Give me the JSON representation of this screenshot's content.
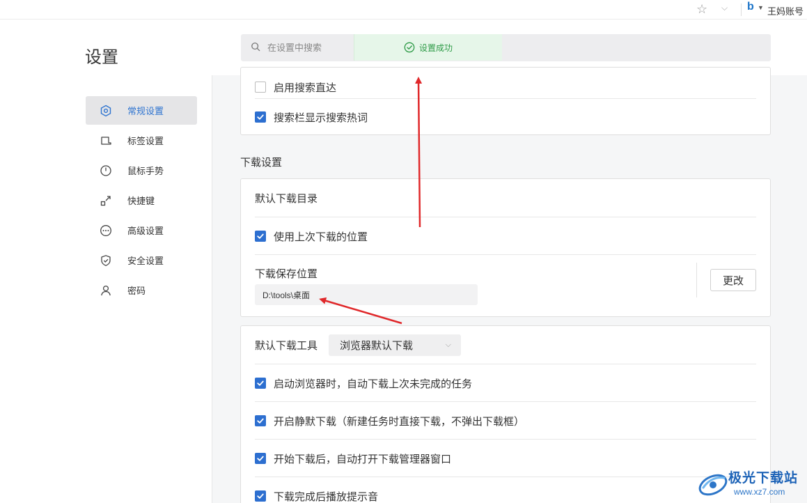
{
  "browser": {
    "account_label": "王妈账号"
  },
  "header": {
    "title": "设置",
    "search_placeholder": "在设置中搜索",
    "toast": "设置成功"
  },
  "sidebar": {
    "items": [
      {
        "label": "常规设置",
        "icon": "hexagon-settings-icon",
        "active": true
      },
      {
        "label": "标签设置",
        "icon": "tab-icon",
        "active": false
      },
      {
        "label": "鼠标手势",
        "icon": "mouse-icon",
        "active": false
      },
      {
        "label": "快捷键",
        "icon": "shortcut-arrow-icon",
        "active": false
      },
      {
        "label": "高级设置",
        "icon": "more-dots-icon",
        "active": false
      },
      {
        "label": "安全设置",
        "icon": "shield-icon",
        "active": false
      },
      {
        "label": "密码",
        "icon": "user-icon",
        "active": false
      }
    ]
  },
  "search_card": {
    "items": [
      {
        "label": "启用搜索直达",
        "checked": false
      },
      {
        "label": "搜索栏显示搜索热词",
        "checked": true
      }
    ]
  },
  "download": {
    "section_title": "下载设置",
    "default_dir_label": "默认下载目录",
    "use_last_location": {
      "label": "使用上次下载的位置",
      "checked": true
    },
    "save_location_label": "下载保存位置",
    "save_path": "D:\\tools\\桌面",
    "change_button": "更改",
    "default_tool_label": "默认下载工具",
    "default_tool_value": "浏览器默认下载",
    "options": [
      {
        "label": "启动浏览器时，自动下载上次未完成的任务",
        "checked": true
      },
      {
        "label": "开启静默下载（新建任务时直接下载，不弹出下载框）",
        "checked": true
      },
      {
        "label": "开始下载后，自动打开下载管理器窗口",
        "checked": true
      },
      {
        "label": "下载完成后播放提示音",
        "checked": true
      }
    ]
  },
  "watermark": {
    "name": "极光下载站",
    "url": "www.xz7.com"
  },
  "colors": {
    "accent": "#2d6fd0",
    "toast_green": "#2e9b47",
    "arrow_red": "#e0282a"
  }
}
